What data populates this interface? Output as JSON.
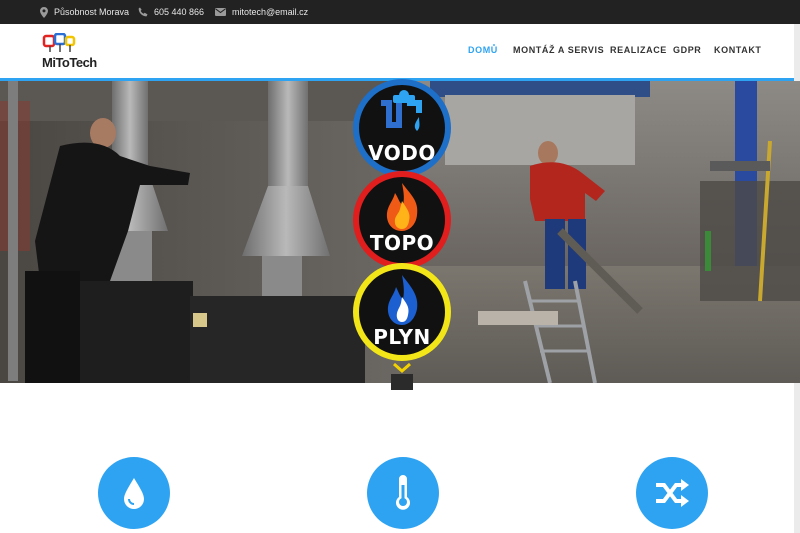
{
  "topbar": {
    "location": "Působnost Morava",
    "phone": "605 440 866",
    "email": "mitotech@email.cz"
  },
  "brand": {
    "logo_text": "MiToTech"
  },
  "nav": {
    "items": [
      {
        "label": "DOMŮ",
        "active": true
      },
      {
        "label": "MONTÁŽ A SERVIS",
        "active": false
      },
      {
        "label": "REALIZACE",
        "active": false
      },
      {
        "label": "GDPR",
        "active": false
      },
      {
        "label": "KONTAKT",
        "active": false
      }
    ]
  },
  "hero": {
    "badges": [
      {
        "label": "VODO",
        "ring_color": "#1e6fc8"
      },
      {
        "label": "TOPO",
        "ring_color": "#e01e1e"
      },
      {
        "label": "PLYN",
        "ring_color": "#f2e619"
      }
    ]
  },
  "features": [
    {
      "icon": "water-drop-icon"
    },
    {
      "icon": "thermometer-icon"
    },
    {
      "icon": "shuffle-icon"
    }
  ],
  "colors": {
    "accent": "#2ea3f2",
    "topbar": "#222222",
    "chevron": "#f2d100"
  }
}
